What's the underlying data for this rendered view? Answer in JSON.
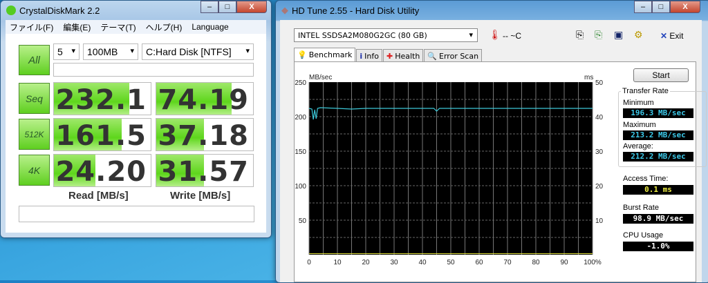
{
  "cdm": {
    "title": "CrystalDiskMark 2.2",
    "menu": [
      "ファイル(F)",
      "編集(E)",
      "テーマ(T)",
      "ヘルプ(H)",
      "Language"
    ],
    "all_label": "All",
    "runs": "5",
    "size": "100MB",
    "drive": "C:Hard Disk [NTFS]",
    "rows": [
      {
        "label": "Seq",
        "read": "232.1",
        "write": "74.19",
        "read_fill": 0.78,
        "write_fill": 0.78
      },
      {
        "label": "512K",
        "read": "161.5",
        "write": "37.18",
        "read_fill": 0.7,
        "write_fill": 0.49
      },
      {
        "label": "4K",
        "read": "24.20",
        "write": "31.57",
        "read_fill": 0.43,
        "write_fill": 0.49
      }
    ],
    "read_header": "Read [MB/s]",
    "write_header": "Write [MB/s]"
  },
  "hdtune": {
    "title": "HD Tune 2.55 - Hard Disk Utility",
    "drive": "INTEL SSDSA2M080G2GC (80 GB)",
    "temp": "-- ~C",
    "exit_label": "Exit",
    "tabs": [
      "Benchmark",
      "Info",
      "Health",
      "Error Scan"
    ],
    "start_label": "Start",
    "transfer_rate_label": "Transfer Rate",
    "min_label": "Minimum",
    "min": "196.3 MB/sec",
    "max_label": "Maximum",
    "max": "213.2 MB/sec",
    "avg_label": "Average:",
    "avg": "212.2 MB/sec",
    "access_label": "Access Time:",
    "access": "0.1 ms",
    "burst_label": "Burst Rate",
    "burst": "98.9 MB/sec",
    "cpu_label": "CPU Usage",
    "cpu": "-1.0%",
    "colors": {
      "transfer": "#3cc8d8",
      "access": "#e8e840"
    }
  },
  "chart_data": {
    "type": "line",
    "ylabel": "MB/sec",
    "y2label": "ms",
    "ylim": [
      0,
      250
    ],
    "y2lim": [
      0,
      50
    ],
    "yticks": [
      "250",
      "200",
      "150",
      "100",
      "50"
    ],
    "y2ticks": [
      "50",
      "40",
      "30",
      "20",
      "10"
    ],
    "xticks": [
      "0",
      "10",
      "20",
      "30",
      "40",
      "50",
      "60",
      "70",
      "80",
      "90",
      "100%"
    ],
    "xlim": [
      0,
      100
    ],
    "series": [
      {
        "name": "Transfer Rate",
        "x": [
          0,
          1,
          1.5,
          2,
          2.5,
          3,
          4,
          10,
          15,
          20,
          30,
          40,
          44,
          45,
          46,
          50,
          60,
          70,
          80,
          90,
          100
        ],
        "y": [
          212,
          211,
          196,
          210,
          197,
          212,
          213,
          212,
          211,
          212,
          212,
          212,
          212,
          208,
          212,
          212,
          212,
          212,
          212,
          212,
          212
        ]
      },
      {
        "name": "Access Time",
        "x": [
          0,
          100
        ],
        "y": [
          0.1,
          0.1
        ]
      }
    ]
  }
}
